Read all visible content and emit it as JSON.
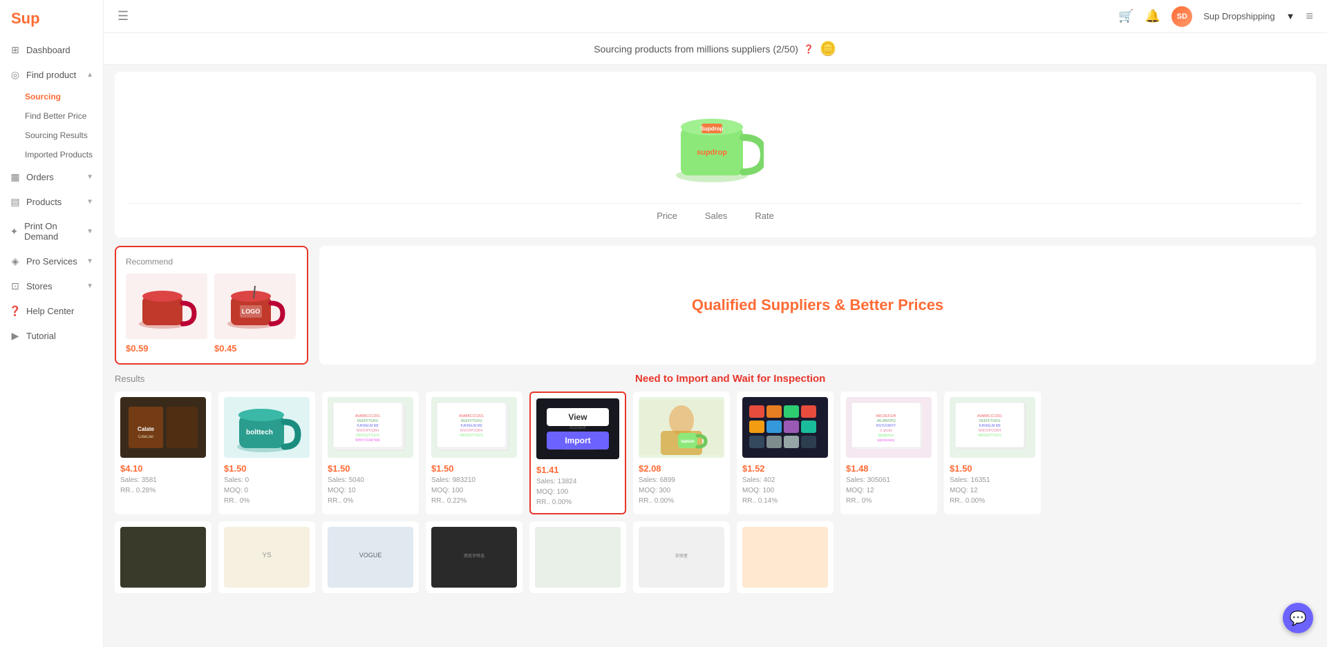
{
  "app": {
    "logo": "Sup",
    "user": "Sup Dropshipping",
    "banner_text": "Sourcing products from millions suppliers (2/50)",
    "banner_help": "?",
    "coins_icon": "💰"
  },
  "sidebar": {
    "logo": "Sup",
    "nav_items": [
      {
        "id": "dashboard",
        "label": "Dashboard",
        "icon": "⊞",
        "has_children": false
      },
      {
        "id": "find-product",
        "label": "Find product",
        "icon": "◎",
        "has_children": true,
        "expanded": true
      },
      {
        "id": "orders",
        "label": "Orders",
        "icon": "▦",
        "has_children": true
      },
      {
        "id": "products",
        "label": "Products",
        "icon": "▤",
        "has_children": true
      },
      {
        "id": "print-on-demand",
        "label": "Print On Demand",
        "icon": "✦",
        "has_children": true
      },
      {
        "id": "pro-services",
        "label": "Pro Services",
        "icon": "◈",
        "has_children": true
      },
      {
        "id": "stores",
        "label": "Stores",
        "icon": "⊡",
        "has_children": true
      },
      {
        "id": "help-center",
        "label": "Help Center",
        "icon": "❓",
        "has_children": false
      },
      {
        "id": "tutorial",
        "label": "Tutorial",
        "icon": "▶",
        "has_children": false
      }
    ],
    "sub_items": [
      {
        "id": "sourcing",
        "label": "Sourcing",
        "active": true
      },
      {
        "id": "find-better-price",
        "label": "Find Better Price"
      },
      {
        "id": "sourcing-results",
        "label": "Sourcing Results"
      },
      {
        "id": "imported-products",
        "label": "Imported Products"
      }
    ]
  },
  "filter_tabs": [
    "Price",
    "Sales",
    "Rate"
  ],
  "recommend": {
    "label": "Recommend",
    "products": [
      {
        "price": "$0.59",
        "alt": "Red mug"
      },
      {
        "price": "$0.45",
        "alt": "Red mug with logo"
      }
    ]
  },
  "qualified": {
    "text": "Qualified Suppliers & Better Prices"
  },
  "results": {
    "label": "Results",
    "need_import_text": "Need to Import and Wait for Inspection",
    "products": [
      {
        "price": "$4.10",
        "sales": "Sales: 3581",
        "rr": "RR.. 0.28%",
        "bg": "choco",
        "alt": "Chocolate powder"
      },
      {
        "price": "$1.50",
        "sales": "Sales: 0",
        "moq": "MOQ: 0",
        "rr": "RR.. 0%",
        "bg": "teal",
        "alt": "Teal mug"
      },
      {
        "price": "$1.50",
        "sales": "Sales: 5040",
        "moq": "MOQ: 10",
        "rr": "RR.. 0%",
        "bg": "colorful",
        "alt": "Colorful stickers"
      },
      {
        "price": "$1.50",
        "sales": "Sales: 983210",
        "moq": "MOQ: 100",
        "rr": "RR.. 0.22%",
        "bg": "colorful",
        "alt": "Colorful stickers 2"
      },
      {
        "price": "$1.41",
        "sales": "Sales: 13824",
        "moq": "MOQ: 100",
        "rr": "RR.. 0.00%",
        "bg": "dark",
        "alt": "Product",
        "highlighted": true
      },
      {
        "price": "$2.08",
        "sales": "Sales: 6899",
        "moq": "MOQ: 300",
        "rr": "RR.. 0.00%",
        "bg": "greenmug",
        "alt": "Green mug girl"
      },
      {
        "price": "$1.52",
        "sales": "Sales: 402",
        "moq": "MOQ: 100",
        "rr": "RR.. 0.14%",
        "bg": "mugset",
        "alt": "Mug set"
      },
      {
        "price": "$1.48",
        "sales": "Sales: 305061",
        "moq": "MOQ: 12",
        "rr": "RR.. 0%",
        "bg": "colorful2",
        "alt": "Colorful stickers 3"
      },
      {
        "price": "$1.50",
        "sales": "Sales: 16351",
        "moq": "MOQ: 12",
        "rr": "RR.. 0.00%",
        "bg": "colorful3",
        "alt": "Colorful stickers 4"
      }
    ],
    "row2_products": [
      {
        "price": "",
        "bg": "misc1",
        "alt": "Misc product 1"
      },
      {
        "price": "",
        "bg": "misc2",
        "alt": "Misc product 2"
      },
      {
        "price": "",
        "bg": "misc3",
        "alt": "Misc product 3"
      },
      {
        "price": "",
        "bg": "misc4",
        "alt": "Misc product 4"
      },
      {
        "price": "",
        "bg": "misc5",
        "alt": "Misc product 5"
      },
      {
        "price": "",
        "bg": "misc6",
        "alt": "Misc product 6"
      },
      {
        "price": "",
        "bg": "misc7",
        "alt": "Misc product 7"
      }
    ],
    "overlay": {
      "view_label": "View",
      "import_label": "Import"
    }
  },
  "colors": {
    "accent": "#ff6b35",
    "danger": "#e8352a",
    "purple": "#6c63ff"
  }
}
